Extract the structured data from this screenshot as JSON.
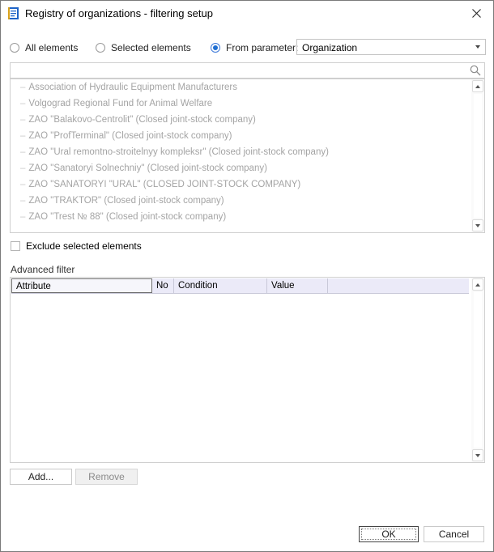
{
  "window": {
    "title": "Registry of organizations - filtering setup"
  },
  "selection": {
    "options": [
      {
        "label": "All elements",
        "checked": false
      },
      {
        "label": "Selected elements",
        "checked": false
      },
      {
        "label": "From parameter:",
        "checked": true
      }
    ],
    "parameter_value": "Organization"
  },
  "search": {
    "value": ""
  },
  "elements_list": [
    "Association of Hydraulic Equipment Manufacturers",
    "Volgograd Regional Fund for Animal Welfare",
    "ZAO \"Balakovo-Centrolit\" (Closed joint-stock company)",
    "ZAO \"ProfTerminal\" (Closed joint-stock company)",
    "ZAO \"Ural remontno-stroitelnyy kompleksr\" (Closed joint-stock company)",
    "ZAO \"Sanatoryi Solnechniy\" (Closed joint-stock company)",
    "ZAO \"SANATORYI \"URAL\" (CLOSED JOINT-STOCK COMPANY)",
    "ZAO \"TRAKTOR\" (Closed joint-stock company)",
    "ZAO \"Trest № 88\" (Closed joint-stock company)"
  ],
  "exclude": {
    "label": "Exclude selected elements",
    "checked": false
  },
  "advanced_filter": {
    "label": "Advanced filter",
    "columns": [
      "Attribute",
      "No",
      "Condition",
      "Value"
    ]
  },
  "buttons": {
    "add": "Add...",
    "remove": "Remove",
    "ok": "OK",
    "cancel": "Cancel"
  },
  "colors": {
    "accent": "#1e6ed1",
    "header_bg": "#ebeaf8",
    "disabled_text": "#a4a4a4"
  }
}
